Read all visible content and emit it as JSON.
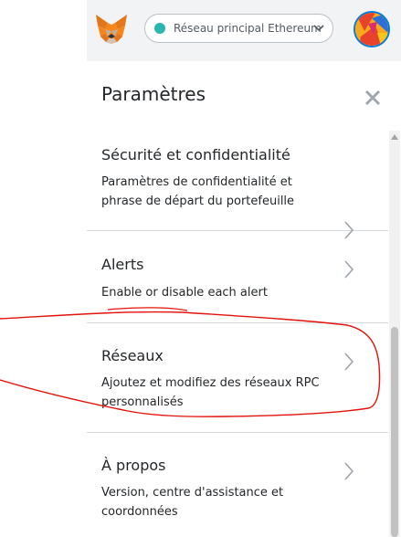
{
  "header": {
    "network_label": "Réseau principal Ethereum",
    "network_dot_color": "#29b6af",
    "logo_icon": "metamask-fox-icon",
    "avatar_icon": "account-identicon"
  },
  "settings": {
    "title": "Paramètres",
    "close_icon": "close-icon",
    "items": [
      {
        "title": "Sécurité et confidentialité",
        "description": "Paramètres de confidentialité et phrase de départ du portefeuille"
      },
      {
        "title": "Alerts",
        "description": "Enable or disable each alert"
      },
      {
        "title": "Réseaux",
        "description": "Ajoutez et modifiez des réseaux RPC personnalisés"
      },
      {
        "title": "À propos",
        "description": "Version, centre d'assistance et coordonnées"
      }
    ]
  },
  "annotation": {
    "color": "#e3120b"
  }
}
